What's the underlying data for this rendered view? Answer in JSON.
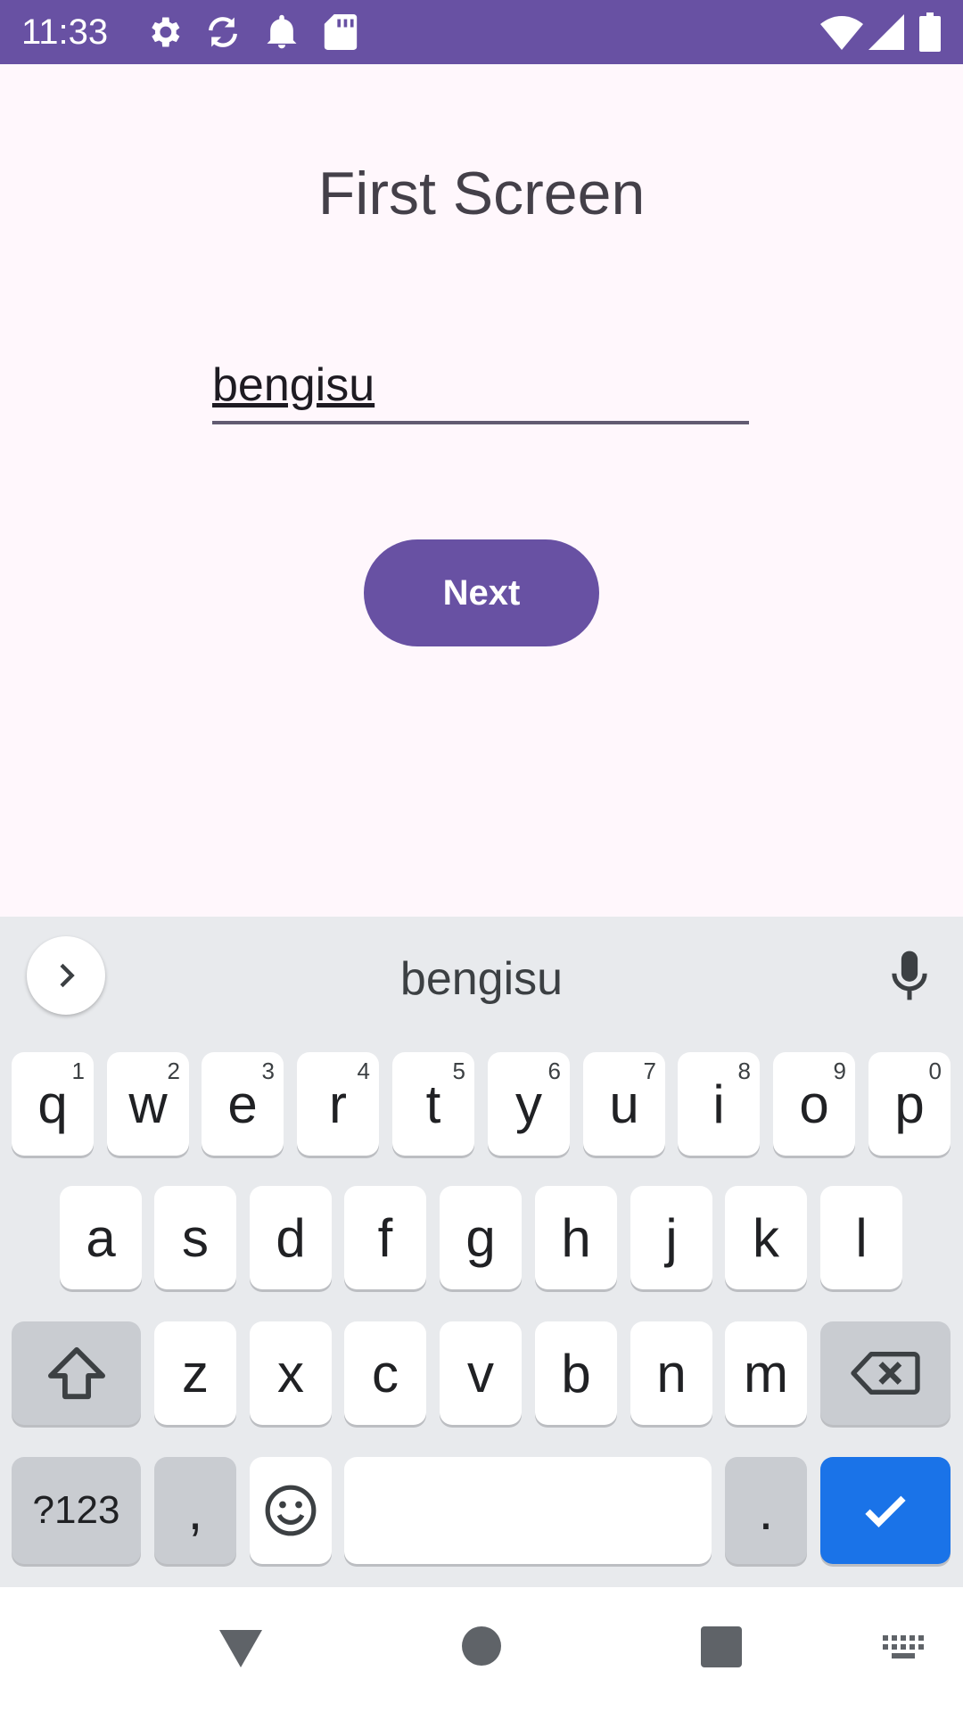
{
  "status_bar": {
    "time": "11:33",
    "left_icons": [
      "settings-icon",
      "sync-icon",
      "notification-bell-icon",
      "sd-card-icon"
    ],
    "right_icons": [
      "wifi-icon",
      "cellular-signal-icon",
      "battery-icon"
    ],
    "background_color": "#6851A3"
  },
  "screen": {
    "title": "First Screen",
    "name_field_value": "bengisu",
    "next_button_label": "Next",
    "accent_color": "#6851A3"
  },
  "keyboard": {
    "suggestion": "bengisu",
    "row1": [
      {
        "key": "q",
        "hint": "1"
      },
      {
        "key": "w",
        "hint": "2"
      },
      {
        "key": "e",
        "hint": "3"
      },
      {
        "key": "r",
        "hint": "4"
      },
      {
        "key": "t",
        "hint": "5"
      },
      {
        "key": "y",
        "hint": "6"
      },
      {
        "key": "u",
        "hint": "7"
      },
      {
        "key": "i",
        "hint": "8"
      },
      {
        "key": "o",
        "hint": "9"
      },
      {
        "key": "p",
        "hint": "0"
      }
    ],
    "row2": [
      "a",
      "s",
      "d",
      "f",
      "g",
      "h",
      "j",
      "k",
      "l"
    ],
    "row3": [
      "z",
      "x",
      "c",
      "v",
      "b",
      "n",
      "m"
    ],
    "symbols_label": "?123",
    "comma_label": ",",
    "period_label": ".",
    "done_color": "#1A73E8"
  },
  "nav_bar": {
    "icons": [
      "back-icon",
      "home-icon",
      "recents-icon",
      "keyboard-switch-icon"
    ]
  }
}
